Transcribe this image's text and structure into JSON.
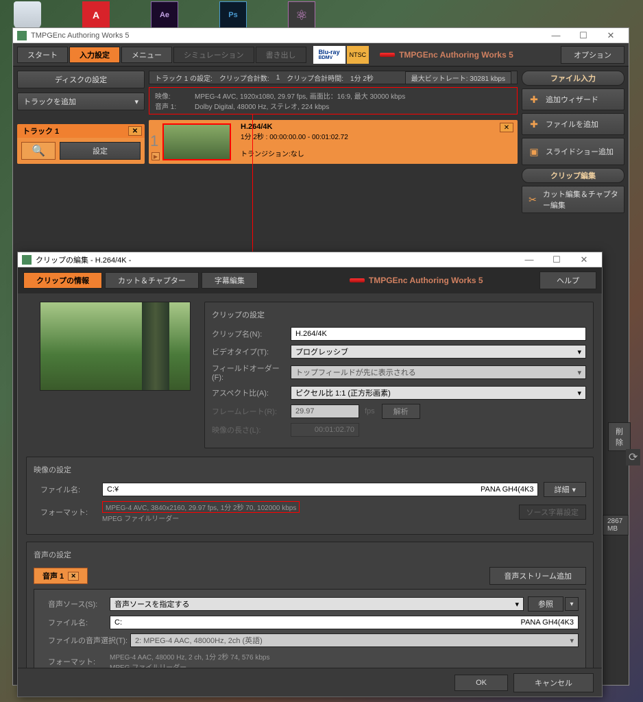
{
  "desktop": {
    "icons": [
      "A",
      "Ae",
      "Ps",
      "⚛"
    ]
  },
  "mainWindow": {
    "title": "TMPGEnc Authoring Works 5",
    "nav": {
      "start": "スタート",
      "input": "入力設定",
      "menu": "メニュー",
      "sim": "シミュレーション",
      "export": "書き出し",
      "bluray_top": "Blu-ray",
      "bluray_bottom": "BDMV",
      "ntsc": "NTSC",
      "brand": "TMPGEnc Authoring Works 5",
      "option": "オプション"
    },
    "left": {
      "disk": "ディスクの設定",
      "addTrack": "トラックを追加",
      "track": "トラック 1",
      "settings": "設定"
    },
    "trackInfo": {
      "prefix": "トラック 1 の設定:",
      "clipCount_label": "クリップ合計数:",
      "clipCount": "1",
      "clipTime_label": "クリップ合計時間:",
      "clipTime": "1分 2秒",
      "bitrate_label": "最大ビットレート:",
      "bitrate": "30281 kbps",
      "video_label": "映像:",
      "video_val": "MPEG-4 AVC, 1920x1080, 29.97 fps, 画面比：16:9, 最大 30000 kbps",
      "audio_label": "音声 1:",
      "audio_val": "Dolby Digital, 48000 Hz, ステレオ, 224 kbps"
    },
    "clip": {
      "num": "1",
      "title": "H.264/4K",
      "duration": "1分 2秒 : 00:00:00.00 - 00:01:02.72",
      "transition": "トランジション:なし"
    },
    "right": {
      "fileInput": "ファイル入力",
      "addWizard": "追加ウィザード",
      "addFile": "ファイルを追加",
      "addSlide": "スライドショー追加",
      "clipEdit": "クリップ編集",
      "cutEdit": "カット編集＆チャプター編集",
      "delete": "削除",
      "memory": "2867 MB"
    }
  },
  "dialog": {
    "title": "クリップの編集 - H.264/4K -",
    "tabs": {
      "info": "クリップの情報",
      "cut": "カット＆チャプター",
      "subtitle": "字幕編集"
    },
    "brand": "TMPGEnc Authoring Works 5",
    "help": "ヘルプ",
    "clipSettings": {
      "title": "クリップの設定",
      "clipName_label": "クリップ名(N):",
      "clipName_val": "H.264/4K",
      "videoType_label": "ビデオタイプ(T):",
      "videoType_val": "プログレッシブ",
      "fieldOrder_label": "フィールドオーダー(F):",
      "fieldOrder_val": "トップフィールドが先に表示される",
      "aspect_label": "アスペクト比(A):",
      "aspect_val": "ピクセル比 1:1 (正方形画素)",
      "frameRate_label": "フレームレート(R):",
      "frameRate_val": "29.97",
      "fps": "fps",
      "analyze": "解析",
      "duration_label": "映像の長さ(L):",
      "duration_val": "00:01:02.70"
    },
    "videoSettings": {
      "title": "映像の設定",
      "file_label": "ファイル名:",
      "file_prefix": "C:¥",
      "file_suffix": "PANA GH4(4K3",
      "format_label": "フォーマット:",
      "format_hl": "MPEG-4 AVC, 3840x2160, 29.97 fps, 1分 2秒 70, 102000 kbps",
      "format_line2": "MPEG ファイルリーダー",
      "detail": "詳細",
      "subtitle_btn": "ソース字幕設定"
    },
    "audioSettings": {
      "title": "音声の設定",
      "tab": "音声 1",
      "addStream": "音声ストリーム追加",
      "source_label": "音声ソース(S):",
      "source_val": "音声ソースを指定する",
      "browse": "参照",
      "file_label": "ファイル名:",
      "file_prefix": "C:",
      "file_suffix": "PANA GH4(4K3",
      "select_label": "ファイルの音声選択(T):",
      "select_val": "2: MPEG-4 AAC, 48000Hz, 2ch (英語)",
      "format_label": "フォーマット:",
      "format_line1": "MPEG-4 AAC, 48000 Hz, 2 ch, 1分 2秒 74, 576 kbps",
      "format_line2": "MPEG ファイルリーダー"
    },
    "footer": {
      "ok": "OK",
      "cancel": "キャンセル"
    }
  }
}
